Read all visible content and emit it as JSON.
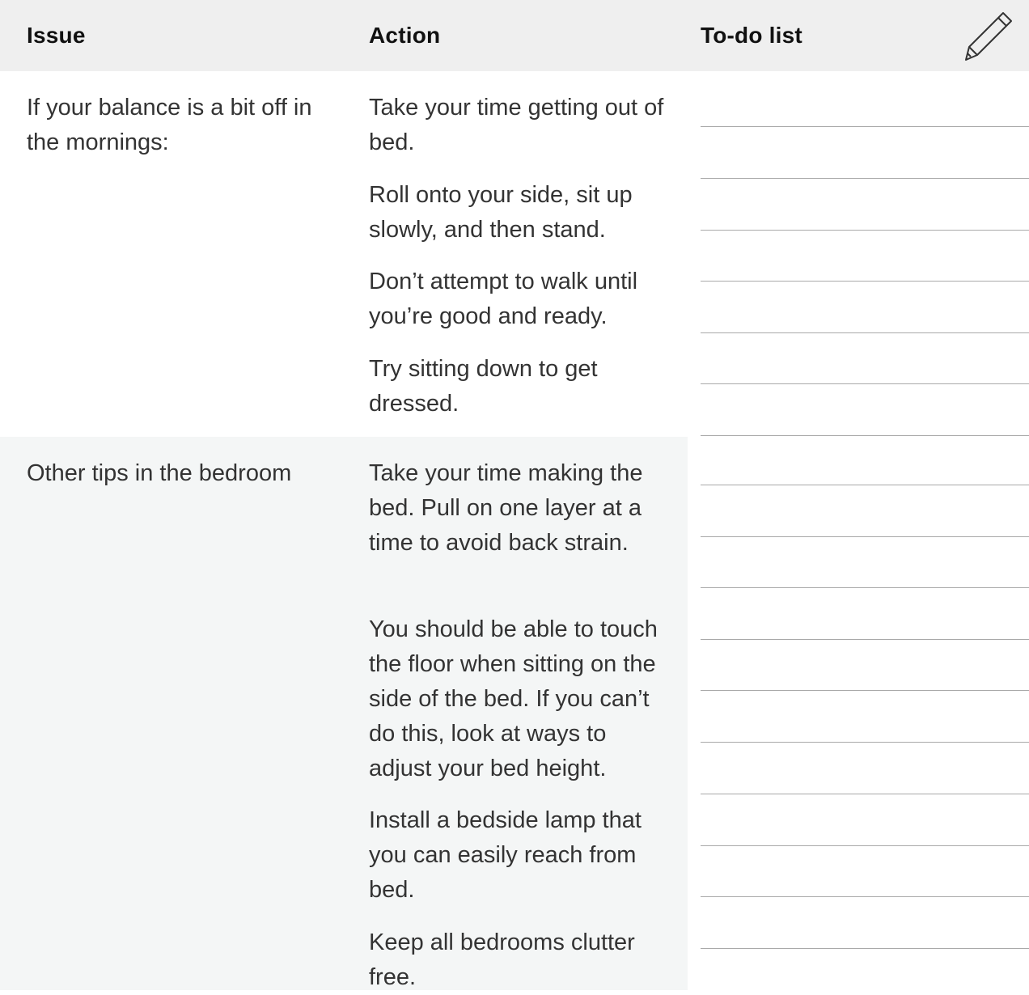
{
  "header": {
    "issue": "Issue",
    "action": "Action",
    "todo": "To-do list",
    "icon": "pencil-icon"
  },
  "sections": [
    {
      "issue": "If your balance is a bit off in the mornings:",
      "actions": [
        "Take your time getting out of bed.",
        "Roll onto your side, sit up slowly, and then stand.",
        "Don’t attempt to walk until you’re good and ready.",
        "Try sitting down to get dressed."
      ]
    },
    {
      "issue": "Other tips in the bedroom",
      "actions": [
        "Take your time making the bed. Pull on one layer at a time to avoid back strain.",
        "You should be able to touch the floor when sitting on the side of the bed. If you can’t do this, look at ways to adjust your bed height.",
        "Install a bedside lamp that you can easily reach from bed.",
        "Keep all bedrooms clutter free."
      ]
    }
  ],
  "colors": {
    "header_bg": "#efefef",
    "band_bg": "#f4f6f6",
    "rule": "#a9a9a9"
  }
}
